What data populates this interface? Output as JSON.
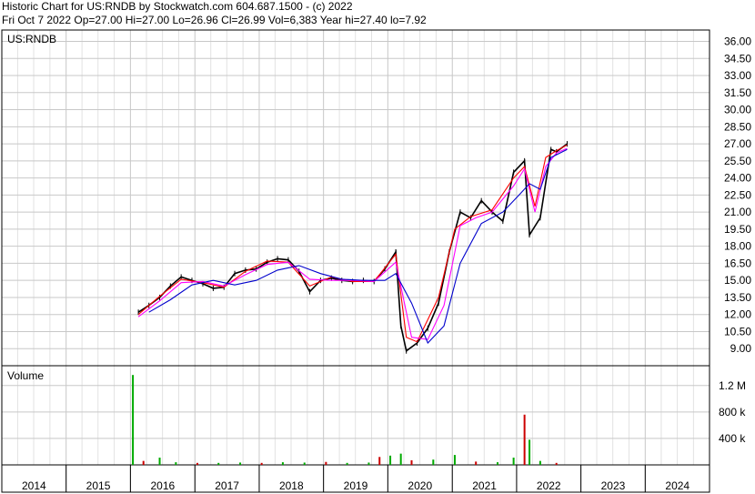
{
  "header": {
    "title_line": "Historic Chart for US:RNDB by Stockwatch.com 604.687.1500 - (c) 2022",
    "quote_line": "Fri Oct  7 2022   Op=27.00  Hi=27.00  Lo=26.96  Cl=26.99  Vol=6,383  Year hi=27.40  lo=7.92"
  },
  "price_panel": {
    "symbol_label": "US:RNDB",
    "y_ticks": [
      "36.00",
      "34.50",
      "33.00",
      "31.50",
      "30.00",
      "28.50",
      "27.00",
      "25.50",
      "24.00",
      "22.50",
      "21.00",
      "19.50",
      "18.00",
      "16.50",
      "15.00",
      "13.50",
      "12.00",
      "10.50",
      "9.00"
    ]
  },
  "volume_panel": {
    "label": "Volume",
    "y_ticks": [
      "1.2 M",
      "800 k",
      "400 k"
    ]
  },
  "x_axis": {
    "year_labels": [
      "2014",
      "2015",
      "2016",
      "2017",
      "2018",
      "2019",
      "2020",
      "2021",
      "2022",
      "2023",
      "2024"
    ]
  },
  "colors": {
    "price_bars": "#000000",
    "ma_short": "#ff0000",
    "ma_mid": "#ff00ff",
    "ma_long": "#0000cc",
    "volume_up": "#00aa00",
    "volume_down": "#cc0000",
    "grid": "#c8c8c8"
  },
  "chart_data": {
    "type": "line",
    "title": "Historic Chart for US:RNDB",
    "ylim": [
      7.5,
      37.0
    ],
    "volume_ylim": [
      0,
      1500000
    ],
    "x_range": [
      "2014-01-01",
      "2024-12-31"
    ],
    "series": [
      {
        "name": "Close",
        "x": [
          "2016-02",
          "2016-04",
          "2016-06",
          "2016-08",
          "2016-10",
          "2016-12",
          "2017-02",
          "2017-04",
          "2017-06",
          "2017-08",
          "2017-10",
          "2017-12",
          "2018-02",
          "2018-04",
          "2018-06",
          "2018-08",
          "2018-10",
          "2018-12",
          "2019-02",
          "2019-04",
          "2019-06",
          "2019-08",
          "2019-10",
          "2019-12",
          "2020-02",
          "2020-03",
          "2020-04",
          "2020-06",
          "2020-08",
          "2020-10",
          "2020-12",
          "2021-02",
          "2021-04",
          "2021-06",
          "2021-08",
          "2021-10",
          "2021-12",
          "2022-02",
          "2022-03",
          "2022-05",
          "2022-07",
          "2022-08",
          "2022-10"
        ],
        "values": [
          12.2,
          12.8,
          13.5,
          14.5,
          15.3,
          15.0,
          14.7,
          14.3,
          14.4,
          15.6,
          15.9,
          16.0,
          16.6,
          16.9,
          16.8,
          15.8,
          14.0,
          15.0,
          15.2,
          15.0,
          14.9,
          15.0,
          14.9,
          16.0,
          17.5,
          11.0,
          8.8,
          9.5,
          10.8,
          13.0,
          17.5,
          21.0,
          20.5,
          22.0,
          21.0,
          20.2,
          24.5,
          25.5,
          19.0,
          20.5,
          26.5,
          26.3,
          27.0
        ]
      },
      {
        "name": "MA short",
        "x": [
          "2016-02",
          "2016-06",
          "2016-10",
          "2017-02",
          "2017-06",
          "2017-10",
          "2018-02",
          "2018-06",
          "2018-10",
          "2019-02",
          "2019-06",
          "2019-10",
          "2020-02",
          "2020-04",
          "2020-06",
          "2020-10",
          "2021-01",
          "2021-04",
          "2021-08",
          "2021-12",
          "2022-02",
          "2022-04",
          "2022-06",
          "2022-08",
          "2022-10"
        ],
        "values": [
          12.0,
          13.6,
          15.1,
          14.8,
          14.4,
          15.8,
          16.7,
          16.6,
          14.5,
          15.3,
          14.9,
          14.9,
          17.3,
          10.0,
          9.6,
          13.5,
          19.5,
          20.6,
          21.2,
          24.0,
          25.0,
          21.5,
          25.8,
          26.4,
          26.9
        ]
      },
      {
        "name": "MA mid",
        "x": [
          "2016-02",
          "2016-06",
          "2016-10",
          "2017-02",
          "2017-06",
          "2017-10",
          "2018-02",
          "2018-06",
          "2018-10",
          "2019-02",
          "2019-06",
          "2019-10",
          "2020-02",
          "2020-05",
          "2020-08",
          "2020-11",
          "2021-02",
          "2021-05",
          "2021-08",
          "2021-12",
          "2022-02",
          "2022-04",
          "2022-06",
          "2022-08",
          "2022-10"
        ],
        "values": [
          11.8,
          13.2,
          14.8,
          14.9,
          14.5,
          15.5,
          16.4,
          16.6,
          15.1,
          15.0,
          15.0,
          14.9,
          16.6,
          10.0,
          9.8,
          12.8,
          19.8,
          20.5,
          21.0,
          23.3,
          24.8,
          21.0,
          25.0,
          26.2,
          26.6
        ]
      },
      {
        "name": "MA long",
        "x": [
          "2016-04",
          "2016-08",
          "2016-12",
          "2017-04",
          "2017-08",
          "2017-12",
          "2018-04",
          "2018-08",
          "2018-12",
          "2019-04",
          "2019-08",
          "2019-12",
          "2020-02",
          "2020-05",
          "2020-08",
          "2020-11",
          "2021-02",
          "2021-06",
          "2021-10",
          "2022-01",
          "2022-03",
          "2022-05",
          "2022-07",
          "2022-10"
        ],
        "values": [
          12.2,
          13.3,
          14.6,
          15.0,
          14.6,
          15.0,
          15.9,
          16.3,
          15.6,
          15.1,
          15.0,
          15.0,
          15.6,
          13.0,
          9.5,
          11.0,
          16.5,
          20.0,
          21.0,
          22.5,
          23.5,
          23.0,
          25.8,
          26.5
        ]
      },
      {
        "name": "Volume",
        "x": [
          "2016-01",
          "2016-03",
          "2016-06",
          "2016-09",
          "2017-01",
          "2017-05",
          "2017-09",
          "2018-01",
          "2018-05",
          "2018-09",
          "2019-01",
          "2019-05",
          "2019-09",
          "2019-11",
          "2020-01",
          "2020-03",
          "2020-05",
          "2020-09",
          "2021-01",
          "2021-05",
          "2021-09",
          "2021-12",
          "2022-02",
          "2022-03",
          "2022-05",
          "2022-08"
        ],
        "values": [
          1360000,
          60000,
          110000,
          40000,
          30000,
          30000,
          35000,
          30000,
          40000,
          35000,
          45000,
          30000,
          35000,
          120000,
          140000,
          170000,
          70000,
          80000,
          150000,
          50000,
          40000,
          110000,
          760000,
          380000,
          60000,
          30000
        ]
      }
    ]
  }
}
